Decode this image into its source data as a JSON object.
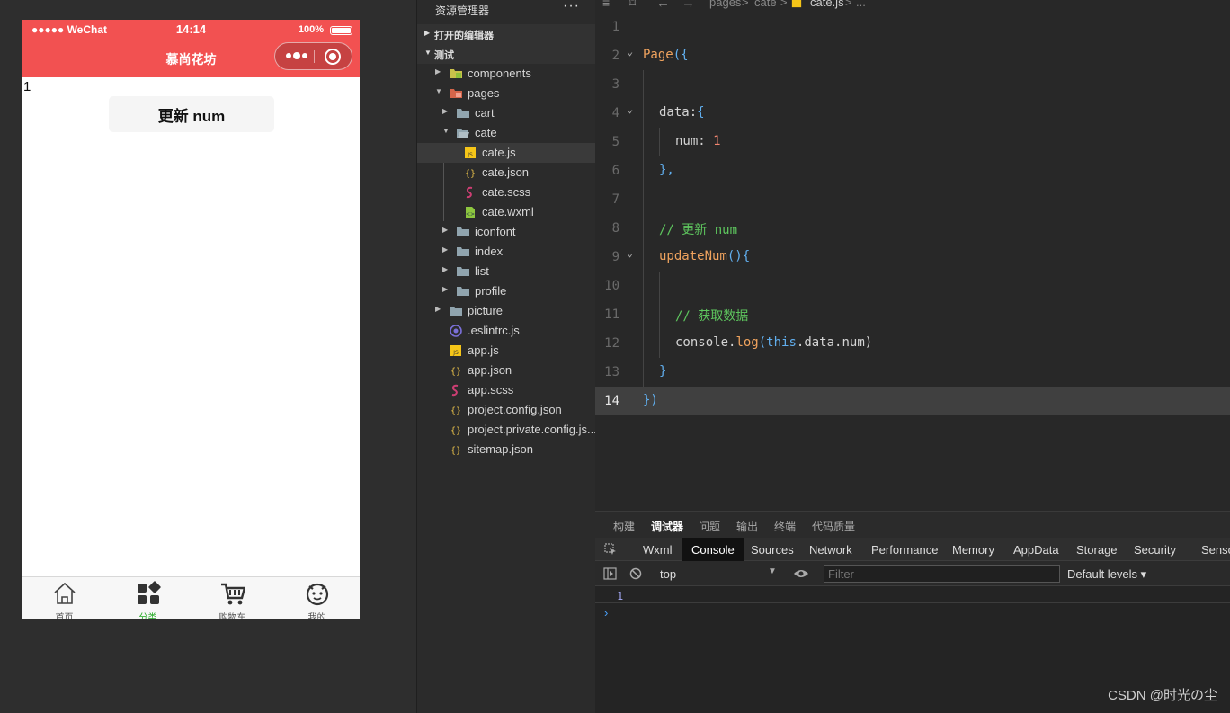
{
  "simulator": {
    "status": {
      "carrier": "●●●●● WeChat",
      "time": "14:14",
      "battery": "100%"
    },
    "title": "慕尚花坊",
    "num_value": "1",
    "button_label": "更新 num",
    "tabs": [
      {
        "label": "首页",
        "icon": "home-icon"
      },
      {
        "label": "分类",
        "icon": "category-icon",
        "active": true
      },
      {
        "label": "购物车",
        "icon": "cart-icon"
      },
      {
        "label": "我的",
        "icon": "profile-icon"
      }
    ]
  },
  "explorer": {
    "title": "资源管理器",
    "more": "···",
    "open_editors": "打开的编辑器",
    "project": "测试",
    "items": {
      "components": "components",
      "pages": "pages",
      "cart": "cart",
      "cate": "cate",
      "cate_js": "cate.js",
      "cate_json": "cate.json",
      "cate_scss": "cate.scss",
      "cate_wxml": "cate.wxml",
      "iconfont": "iconfont",
      "index": "index",
      "list": "list",
      "profile": "profile",
      "picture": "picture",
      "eslintrc": ".eslintrc.js",
      "app_js": "app.js",
      "app_json": "app.json",
      "app_scss": "app.scss",
      "project_config": "project.config.json",
      "project_private": "project.private.config.js...",
      "sitemap": "sitemap.json"
    }
  },
  "editor": {
    "breadcrumb": [
      "pages",
      ">",
      "cate",
      ">",
      "cate.js",
      ">",
      "..."
    ],
    "line_numbers": [
      "1",
      "2",
      "3",
      "4",
      "5",
      "6",
      "7",
      "8",
      "9",
      "10",
      "11",
      "12",
      "13",
      "14"
    ],
    "code": {
      "l2": "Page",
      "l2b": "({",
      "l4": "data:",
      "l4b": "{",
      "l5": "num: ",
      "l5n": "1",
      "l6": "},",
      "l8": "// 更新 num",
      "l9": "updateNum",
      "l9b": "(){",
      "l11": "// 获取数据",
      "l12a": "console.",
      "l12b": "log",
      "l12c": "(",
      "l12d": "this",
      "l12e": ".data.num)",
      "l13": "}",
      "l14": "})"
    }
  },
  "devtools": {
    "top_tabs": [
      "构建",
      "调试器",
      "问题",
      "输出",
      "终端",
      "代码质量"
    ],
    "panel_tabs": [
      "Wxml",
      "Console",
      "Sources",
      "Network",
      "Performance",
      "Memory",
      "AppData",
      "Storage",
      "Security",
      "Senso"
    ],
    "context": "top",
    "filter_placeholder": "Filter",
    "levels": "Default levels ▾",
    "console_value": "1",
    "prompt": "›"
  },
  "watermark": "CSDN @时光の尘"
}
